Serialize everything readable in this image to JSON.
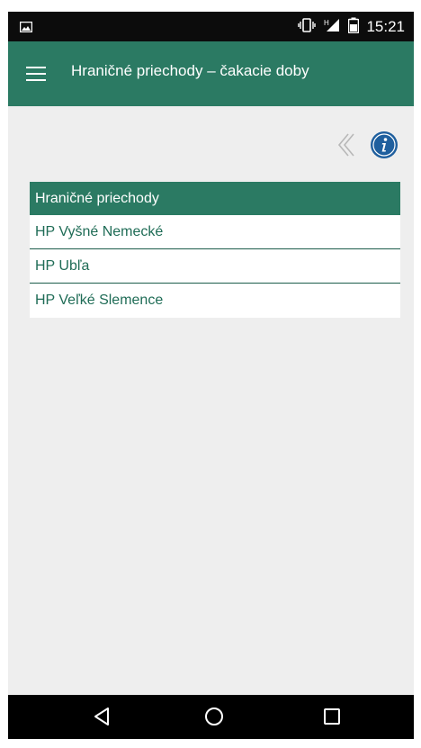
{
  "status_bar": {
    "time": "15:21",
    "icons": [
      "image-icon",
      "vibrate-icon",
      "signal-icon",
      "battery-icon"
    ]
  },
  "app_bar": {
    "title": "Hraničné priechody – čakacie doby",
    "icon": "hamburger-menu-icon"
  },
  "toolbar": {
    "icons": [
      "back-chevron-icon",
      "info-icon"
    ]
  },
  "list": {
    "header": "Hraničné priechody",
    "items": [
      {
        "label": "HP Vyšné Nemecké"
      },
      {
        "label": "HP Ubľa"
      },
      {
        "label": "HP Veľké Slemence"
      }
    ]
  },
  "nav_bar": {
    "icons": [
      "back-icon",
      "home-icon",
      "recents-icon"
    ]
  },
  "colors": {
    "primary": "#2b7a63",
    "background": "#eeeeee",
    "item_text": "#1f6c56",
    "info_blue": "#1f5f9e"
  }
}
